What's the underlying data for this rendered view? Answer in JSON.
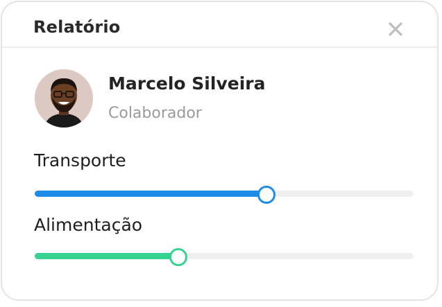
{
  "dialog": {
    "title": "Relatório",
    "close_icon": "close-icon"
  },
  "profile": {
    "name": "Marcelo Silveira",
    "role": "Colaborador",
    "avatar": "avatar"
  },
  "sliders": [
    {
      "label": "Transporte",
      "value": 0.61,
      "color": "#1d8be8"
    },
    {
      "label": "Alimentação",
      "value": 0.377,
      "color": "#36d28f"
    }
  ]
}
